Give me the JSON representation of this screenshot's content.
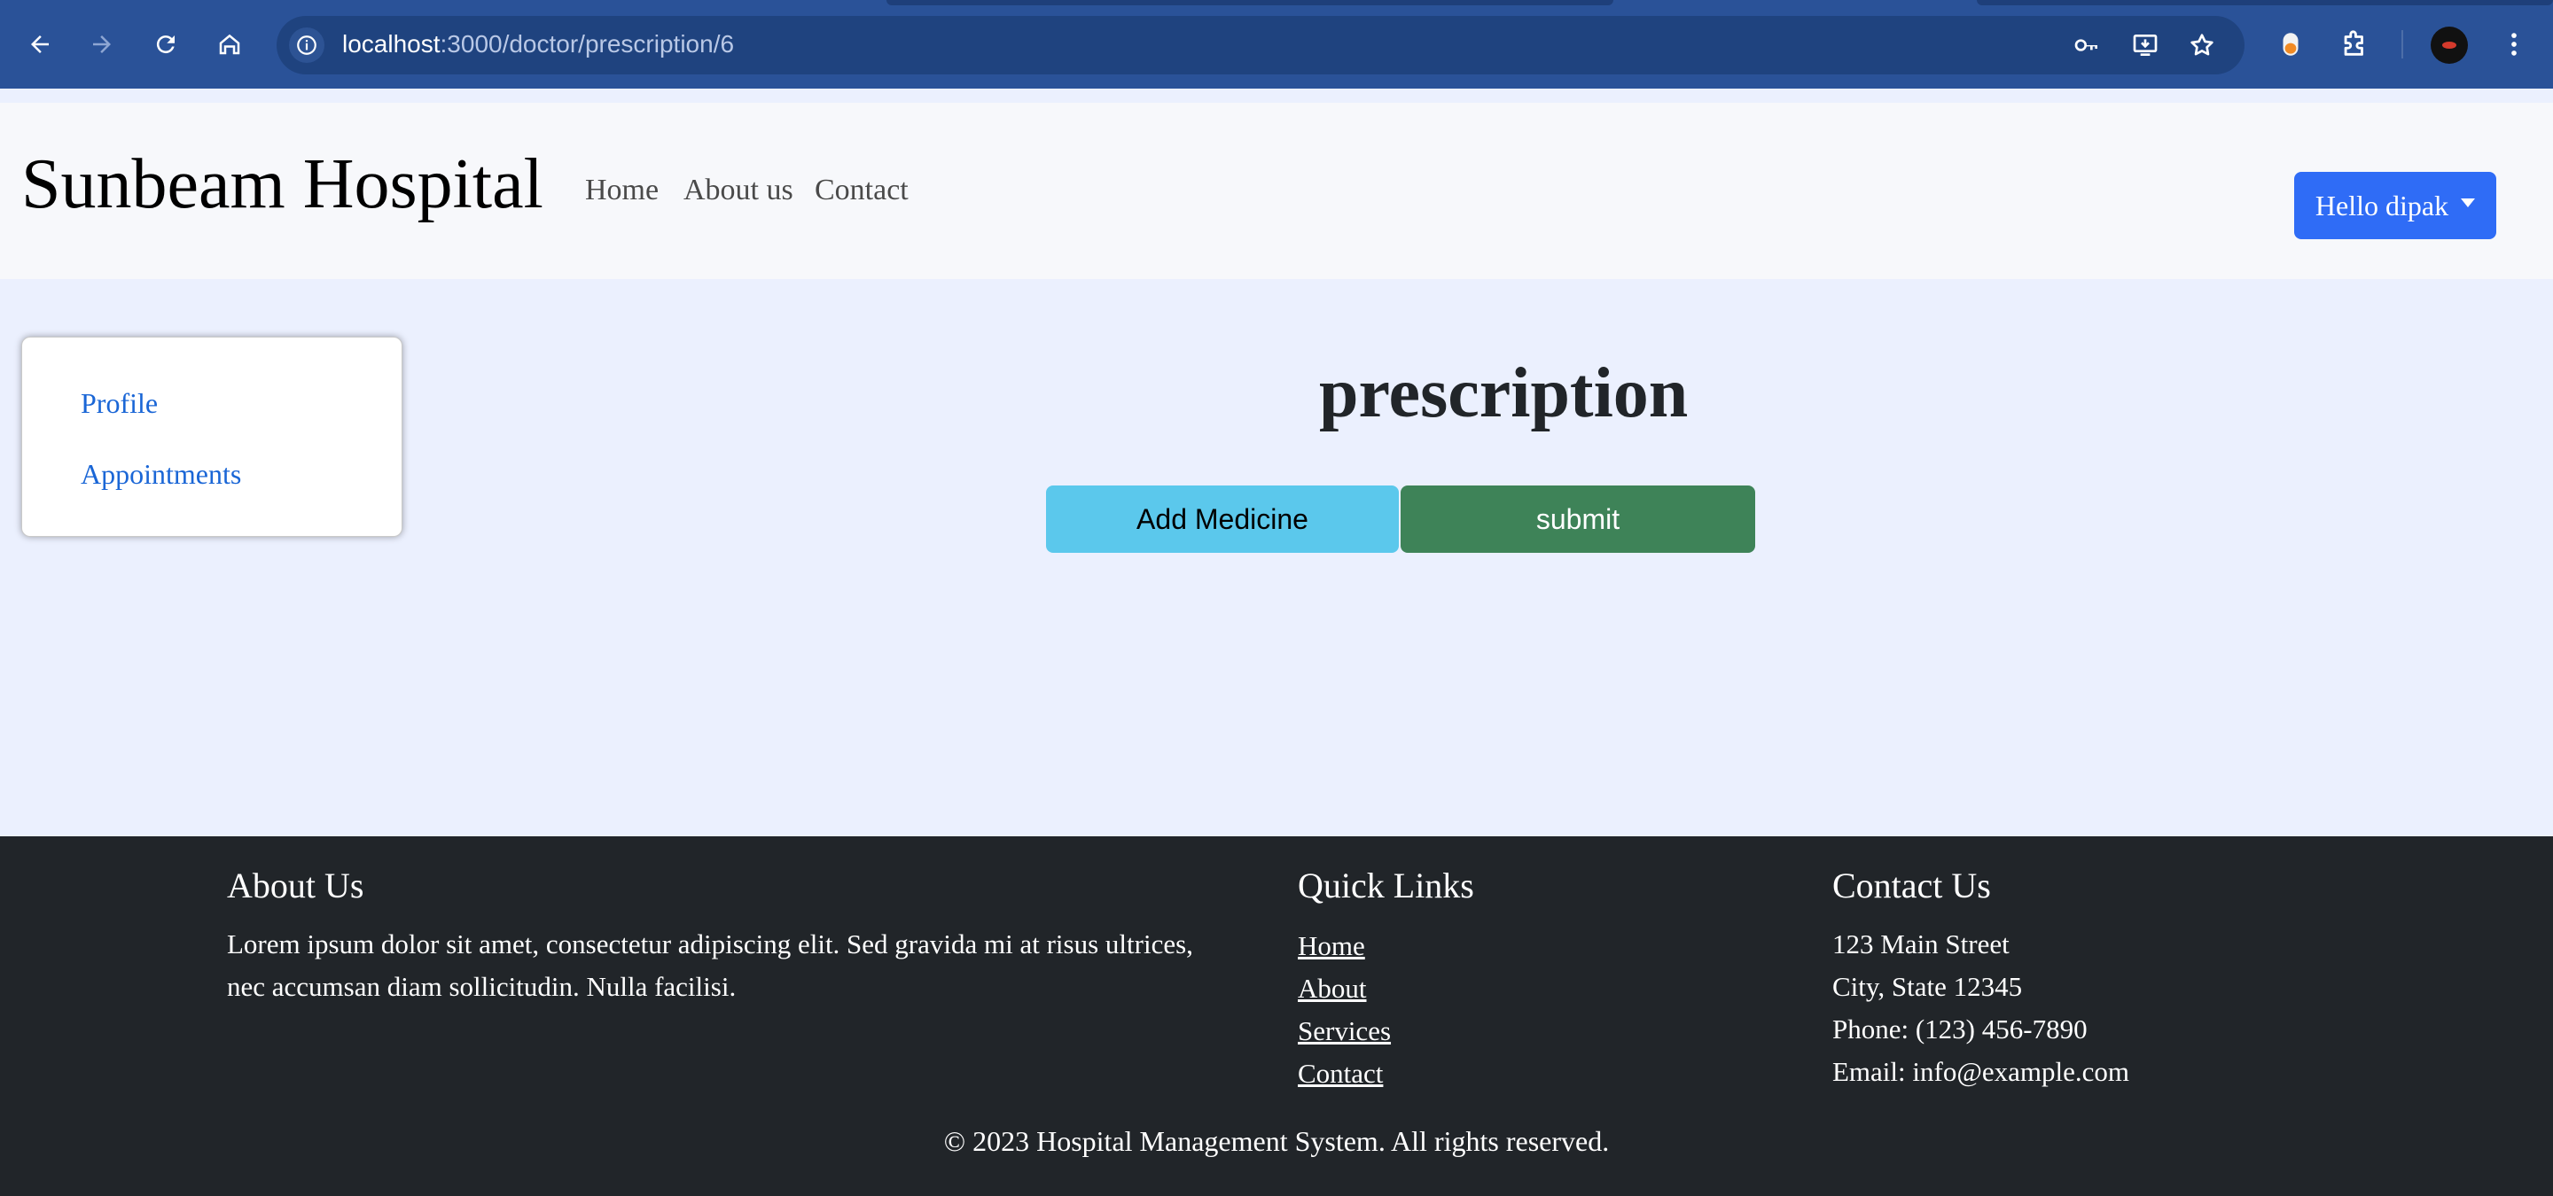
{
  "browser": {
    "url_host": "localhost",
    "url_path": ":3000/doctor/prescription/6",
    "icons": {
      "back": "back-arrow-icon",
      "forward": "forward-arrow-icon",
      "reload": "reload-icon",
      "home": "home-icon",
      "site_info": "info-icon",
      "passwords": "key-icon",
      "install": "install-app-icon",
      "bookmark": "star-icon",
      "extension_app": "extension-app-icon",
      "extensions": "puzzle-icon",
      "profile": "avatar",
      "menu": "kebab-menu-icon"
    }
  },
  "navbar": {
    "brand": "Sunbeam Hospital",
    "links": [
      "Home",
      "About us",
      "Contact"
    ],
    "user_button": "Hello dipak"
  },
  "sidebar": {
    "items": [
      "Profile",
      "Appointments"
    ]
  },
  "main": {
    "title": "prescription",
    "add_button": "Add Medicine",
    "submit_button": "submit"
  },
  "footer": {
    "about": {
      "heading": "About Us",
      "lines": [
        "Lorem ipsum dolor sit amet, consectetur adipiscing elit. Sed gravida mi at risus ultrices,",
        "nec accumsan diam sollicitudin. Nulla facilisi."
      ]
    },
    "quick_links": {
      "heading": "Quick Links",
      "links": [
        "Home",
        "About",
        "Services",
        "Contact"
      ]
    },
    "contact": {
      "heading": "Contact Us",
      "lines": [
        "123 Main Street",
        "City, State 12345",
        "Phone: (123) 456-7890",
        "Email: info@example.com"
      ]
    },
    "copyright": "© 2023 Hospital Management System. All rights reserved."
  },
  "colors": {
    "chrome_bg": "#2a5298",
    "primary_button": "#2f6cf6",
    "info_button": "#5bc8ec",
    "success_button": "#3e8358",
    "footer_bg": "#212529",
    "link": "#1a66d6"
  }
}
